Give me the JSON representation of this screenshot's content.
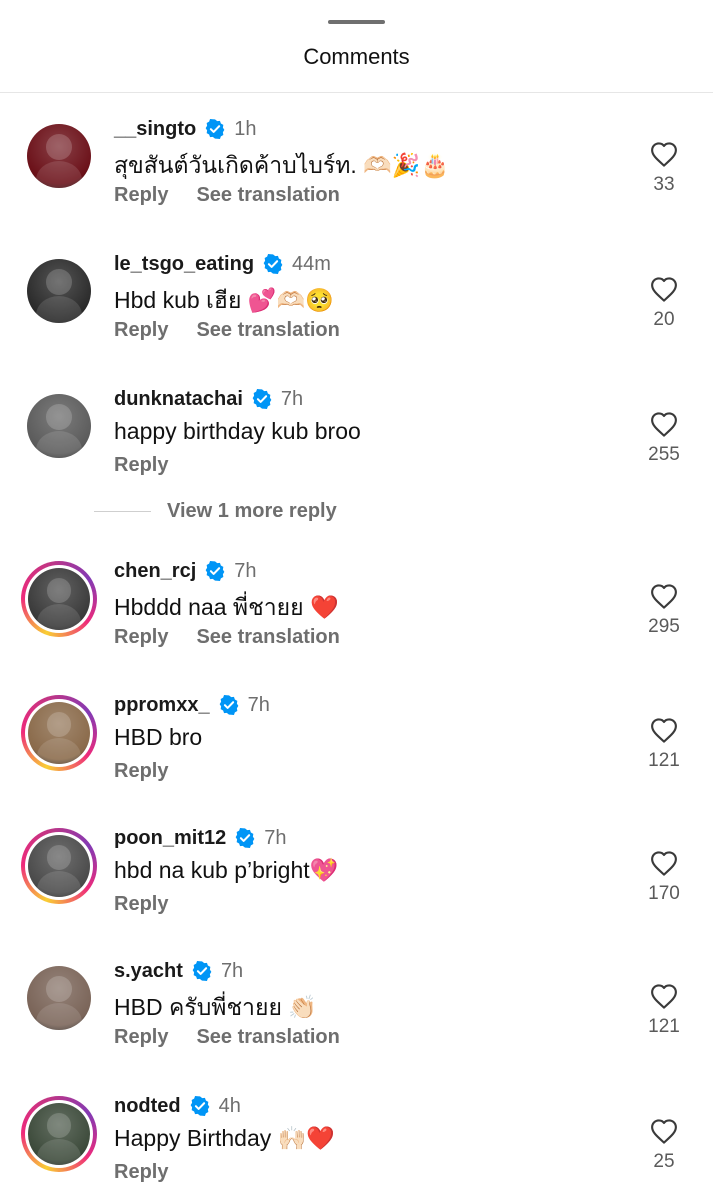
{
  "sheet": {
    "title": "Comments"
  },
  "comments": [
    {
      "username": "__singto",
      "time": "1h",
      "text": "สุขสันต์วันเกิดค้าบไบร์ท. 🫶🏻🎉🎂",
      "reply": "Reply",
      "see_translation": "See translation",
      "likes": "33",
      "story": false,
      "avatar_color": "#6b1018"
    },
    {
      "username": "le_tsgo_eating",
      "time": "44m",
      "text": "Hbd kub เฮีย 💕🫶🏻🥺",
      "reply": "Reply",
      "see_translation": "See translation",
      "likes": "20",
      "story": false,
      "avatar_color": "#2a2a2a"
    },
    {
      "username": "dunknatachai",
      "time": "7h",
      "text": "happy birthday kub broo",
      "reply": "Reply",
      "see_translation": "",
      "likes": "255",
      "story": false,
      "avatar_color": "#5b5b5b"
    },
    {
      "username": "chen_rcj",
      "time": "7h",
      "text": "Hbddd naa พี่ชายย ❤️",
      "reply": "Reply",
      "see_translation": "See translation",
      "likes": "295",
      "story": true,
      "avatar_color": "#3a3a3a"
    },
    {
      "username": "ppromxx_",
      "time": "7h",
      "text": "HBD bro",
      "reply": "Reply",
      "see_translation": "",
      "likes": "121",
      "story": true,
      "avatar_color": "#8a6a4a"
    },
    {
      "username": "poon_mit12",
      "time": "7h",
      "text": "hbd na kub p’bright💖",
      "reply": "Reply",
      "see_translation": "",
      "likes": "170",
      "story": true,
      "avatar_color": "#4a4a4a"
    },
    {
      "username": "s.yacht",
      "time": "7h",
      "text": "HBD ครับพี่ชายย 👏🏻",
      "reply": "Reply",
      "see_translation": "See translation",
      "likes": "121",
      "story": false,
      "avatar_color": "#7a6458"
    },
    {
      "username": "nodted",
      "time": "4h",
      "text": "Happy Birthday 🙌🏻❤️",
      "reply": "Reply",
      "see_translation": "",
      "likes": "25",
      "story": true,
      "avatar_color": "#3c4a3a"
    }
  ],
  "view_more": {
    "label": "View 1 more reply"
  },
  "colors": {
    "verified": "#0095f6",
    "story_gradient": [
      "#f9ce34",
      "#ee2a7b",
      "#6228d7"
    ]
  },
  "icons": {
    "like": "heart-outline-icon",
    "verified": "verified-badge-icon"
  }
}
